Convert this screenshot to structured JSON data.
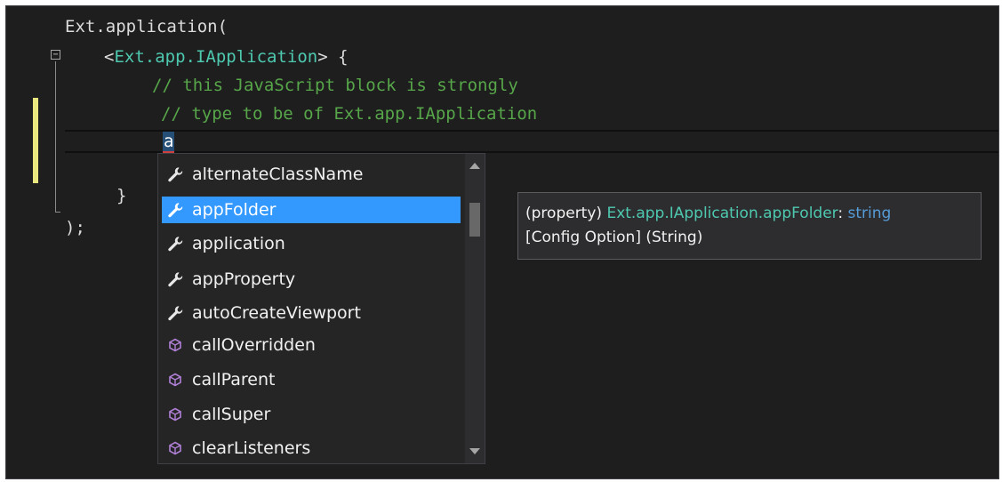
{
  "code": {
    "line1": "Ext.application(",
    "line2_open": "<",
    "line2_type": "Ext.app.IApplication",
    "line2_close": "> {",
    "comment1": "// this JavaScript block is strongly",
    "comment2": "// type to be of Ext.app.IApplication",
    "typed": "a",
    "close_brace": "}",
    "close_paren": ");",
    "fold_symbol": "−"
  },
  "completion": {
    "items": [
      {
        "label": "alternateClassName",
        "icon": "wrench-icon"
      },
      {
        "label": "appFolder",
        "icon": "wrench-icon",
        "selected": true
      },
      {
        "label": "application",
        "icon": "wrench-icon"
      },
      {
        "label": "appProperty",
        "icon": "wrench-icon"
      },
      {
        "label": "autoCreateViewport",
        "icon": "wrench-icon"
      },
      {
        "label": "callOverridden",
        "icon": "method-cube-icon"
      },
      {
        "label": "callParent",
        "icon": "method-cube-icon"
      },
      {
        "label": "callSuper",
        "icon": "method-cube-icon"
      },
      {
        "label": "clearListeners",
        "icon": "method-cube-icon"
      }
    ]
  },
  "tooltip": {
    "prefix": "(property) ",
    "type": "Ext.app.IApplication.appFolder",
    "colon": ": ",
    "kind": "string",
    "line2": "[Config Option] (String)"
  },
  "colors": {
    "background": "#1e1e1e",
    "type": "#4ec9b0",
    "comment": "#57a64a",
    "keyword": "#569cd6",
    "selection": "#3399ff",
    "method_icon": "#b180d7"
  }
}
